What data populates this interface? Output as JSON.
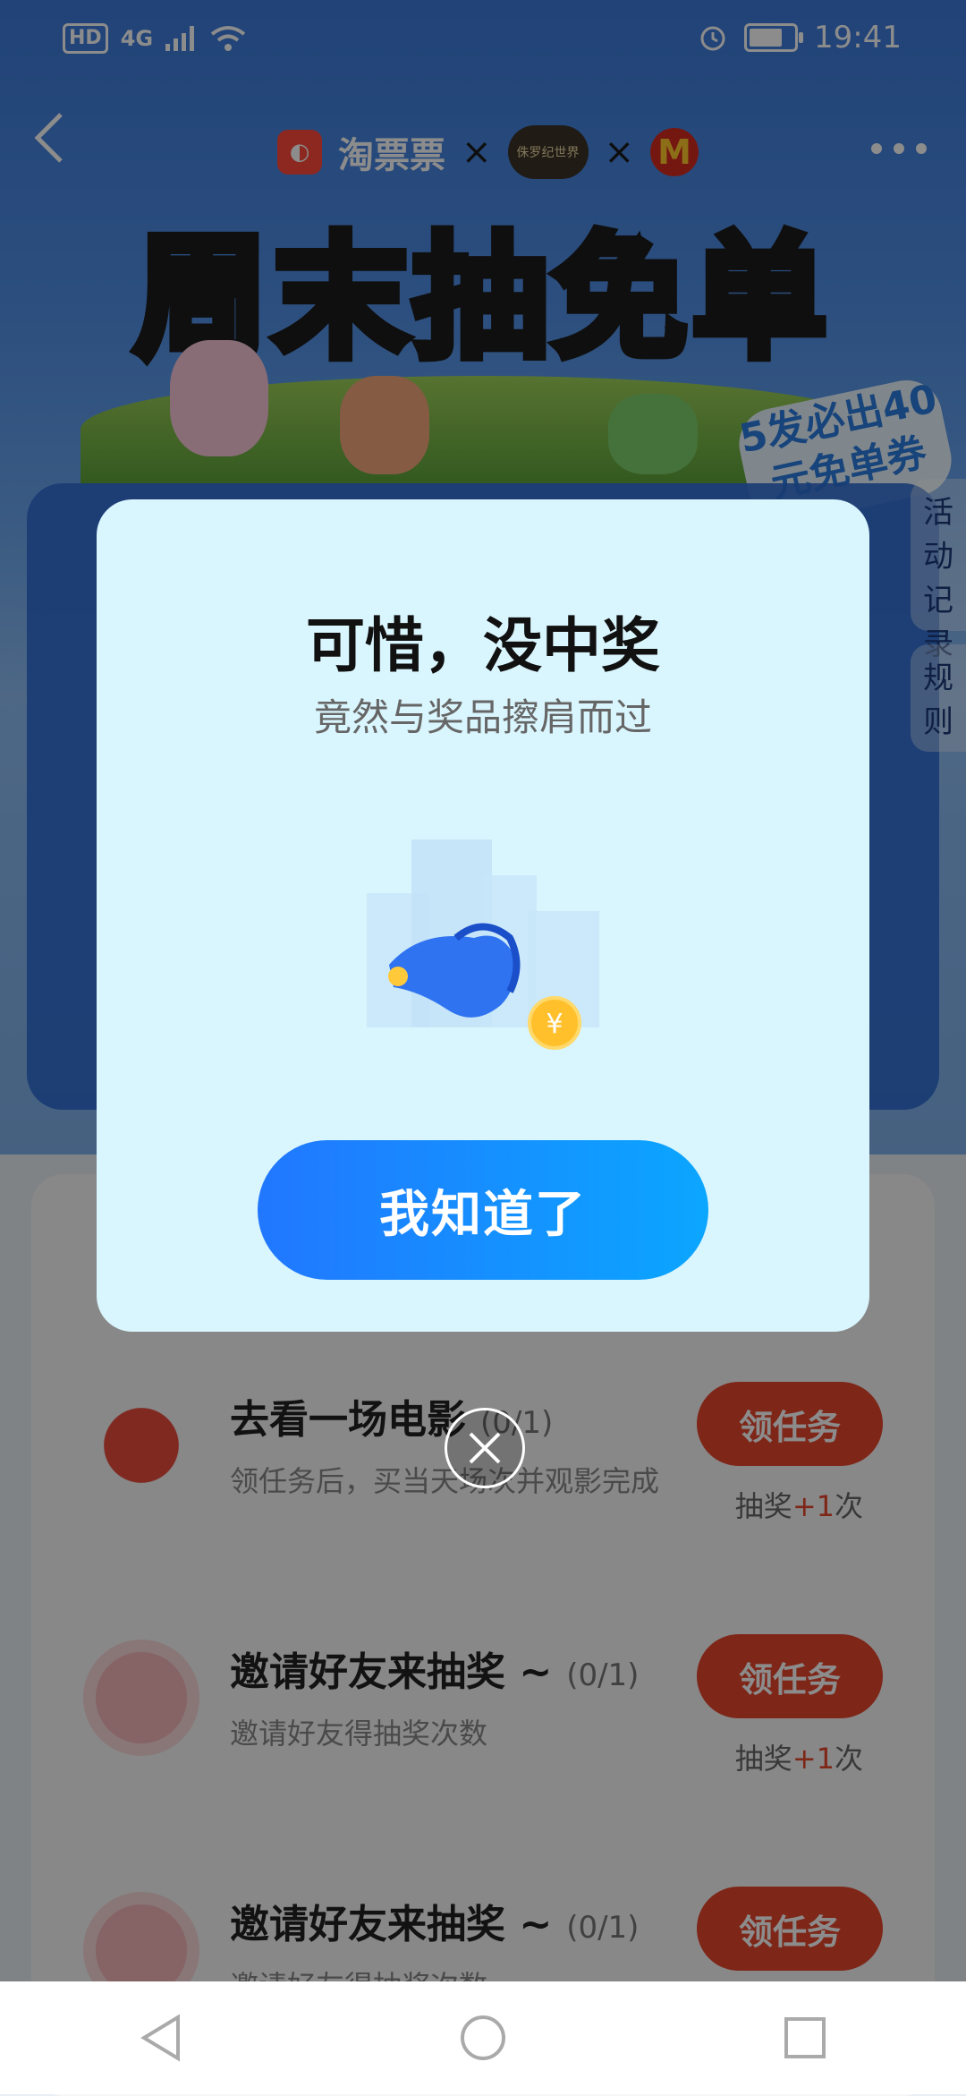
{
  "status_bar": {
    "hd": "HD",
    "network": "4G",
    "time": "19:41"
  },
  "header": {
    "brand_name": "淘票票",
    "separator": "×",
    "movie_logo_text": "侏罗纪世界",
    "mcd_logo_text": "M"
  },
  "banner": {
    "title": "周末抽免单",
    "badge_text": "5发必出40元免单券"
  },
  "side_tabs": {
    "activity_record": "活动记录",
    "rules": "规则"
  },
  "dialog": {
    "title": "可惜，没中奖",
    "subtitle": "竟然与奖品擦肩而过",
    "coin_symbol": "¥",
    "confirm_label": "我知道了"
  },
  "tasks": [
    {
      "title": "去看一场电影",
      "progress": "(0/1)",
      "description": "领任务后，买当天场次并观影完成",
      "button": "领任务",
      "reward_prefix": "抽奖",
      "reward_plus": "+1",
      "reward_suffix": "次"
    },
    {
      "title": "邀请好友来抽奖 ~",
      "progress": "(0/1)",
      "description": "邀请好友得抽奖次数",
      "button": "领任务",
      "reward_prefix": "抽奖",
      "reward_plus": "+1",
      "reward_suffix": "次"
    },
    {
      "title": "邀请好友来抽奖 ~",
      "progress": "(0/1)",
      "description": "邀请好友得抽奖次数",
      "button": "领任务"
    }
  ],
  "colors": {
    "accent_blue": "#2177ff",
    "task_button": "#e6452c",
    "dialog_bg": "#d9f5fd"
  }
}
